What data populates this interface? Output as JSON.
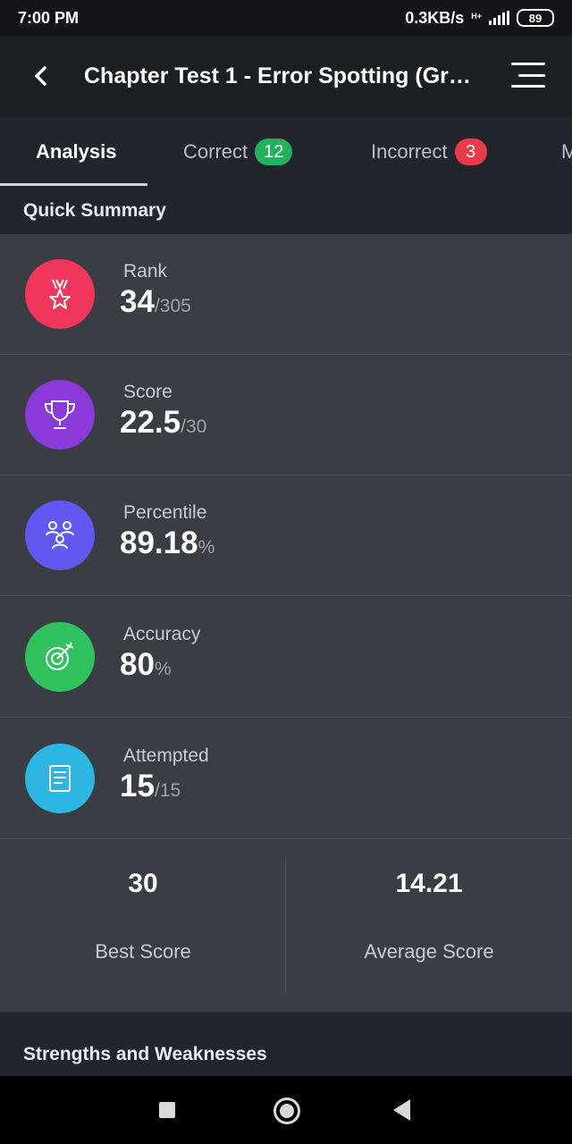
{
  "status": {
    "time": "7:00 PM",
    "network_speed": "0.3KB/s",
    "network_type": "H+",
    "battery": "89"
  },
  "header": {
    "title": "Chapter Test 1 -  Error Spotting (Gra..."
  },
  "tabs": [
    {
      "label": "Analysis"
    },
    {
      "label": "Correct",
      "count": "12"
    },
    {
      "label": "Incorrect",
      "count": "3"
    },
    {
      "label": "M"
    }
  ],
  "quick_summary": {
    "title": "Quick Summary",
    "stats": [
      {
        "label": "Rank",
        "value": "34",
        "suffix": "/305",
        "icon": "rank-medal-icon",
        "color": "#f0365a"
      },
      {
        "label": "Score",
        "value": "22.5",
        "suffix": "/30",
        "icon": "trophy-icon",
        "color": "#8a3ad9"
      },
      {
        "label": "Percentile",
        "value": "89.18",
        "suffix": "%",
        "icon": "people-group-icon",
        "color": "#6158f0"
      },
      {
        "label": "Accuracy",
        "value": "80",
        "suffix": "%",
        "icon": "target-arrow-icon",
        "color": "#2fc25f"
      },
      {
        "label": "Attempted",
        "value": "15",
        "suffix": "/15",
        "icon": "checklist-icon",
        "color": "#2db6e4"
      }
    ],
    "best_score": {
      "value": "30",
      "label": "Best Score"
    },
    "average_score": {
      "value": "14.21",
      "label": "Average Score"
    }
  },
  "strengths": {
    "title": "Strengths and Weaknesses"
  }
}
